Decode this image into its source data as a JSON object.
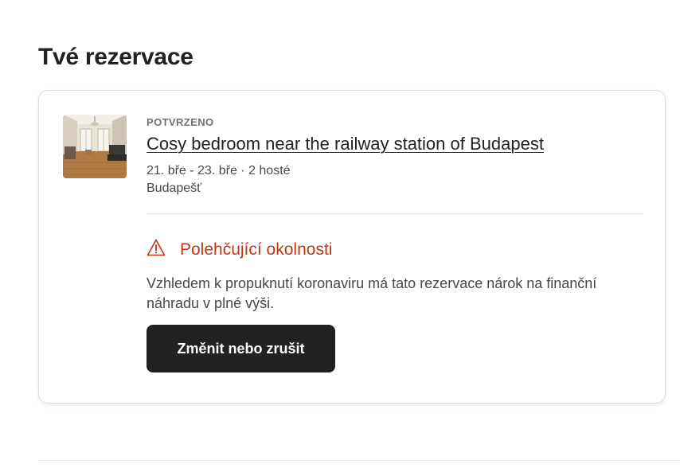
{
  "page": {
    "title": "Tvé rezervace"
  },
  "reservation": {
    "status": "POTVRZENO",
    "listing_title": "Cosy bedroom near the railway station of Budapest",
    "dates_guests": "21. bře - 23. bře · 2 hosté",
    "location": "Budapešť",
    "thumbnail_icon": "listing-photo",
    "notice": {
      "icon": "warning-icon",
      "title": "Polehčující okolnosti",
      "body": "Vzhledem k propuknutí koronaviru má tato rezervace nárok na finanční náhradu v plné výši."
    },
    "action_label": "Změnit nebo zrušit"
  },
  "colors": {
    "text_primary": "#222222",
    "text_secondary": "#484848",
    "status_gray": "#717171",
    "warning_red": "#c13515",
    "button_bg": "#222222",
    "button_text": "#ffffff"
  }
}
